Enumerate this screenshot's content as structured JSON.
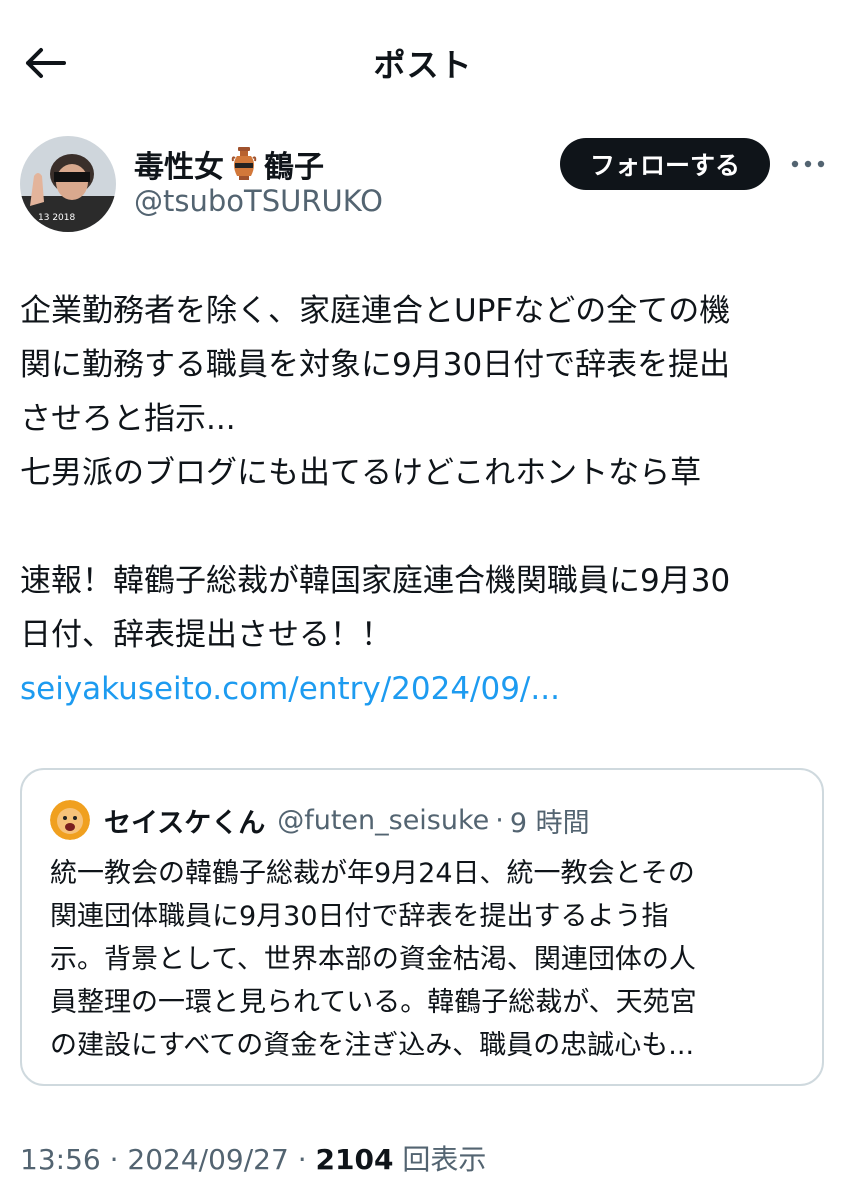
{
  "header": {
    "title": "ポスト"
  },
  "author": {
    "name_part1": "毒性女",
    "name_part2": "鶴子",
    "handle": "@tsuboTSURUKO",
    "avatar_text": "13 2018"
  },
  "follow_button": {
    "label": "フォローする"
  },
  "post": {
    "lines": [
      "企業勤務者を除く、家庭連合とUPFなどの全ての機",
      "関に勤務する職員を対象に9月30日付で辞表を提出",
      "させろと指示...",
      "七男派のブログにも出てるけどこれホントなら草",
      "",
      "速報！韓鶴子総裁が韓国家庭連合機関職員に9月30",
      "日付、辞表提出させる！！"
    ],
    "link": "seiyakuseito.com/entry/2024/09/..."
  },
  "quote": {
    "name": "セイスケくん",
    "handle": "@futen_seisuke",
    "separator": "·",
    "time": "9 時間",
    "lines": [
      "統一教会の韓鶴子総裁が年9月24日、統一教会とその",
      "関連団体職員に9月30日付で辞表を提出するよう指",
      "示。背景として、世界本部の資金枯渇、関連団体の人",
      "員整理の一環と見られている。韓鶴子総裁が、天苑宮",
      "の建設にすべての資金を注ぎ込み、職員の忠誠心も..."
    ]
  },
  "meta": {
    "time": "13:56",
    "separator": "·",
    "date": "2024/09/27",
    "views_count": "2104",
    "views_label": "回表示"
  },
  "colors": {
    "text": "#0f1419",
    "secondary": "#536471",
    "link": "#1d9bf0",
    "border": "#cfd9de",
    "button_bg": "#0f1419"
  }
}
